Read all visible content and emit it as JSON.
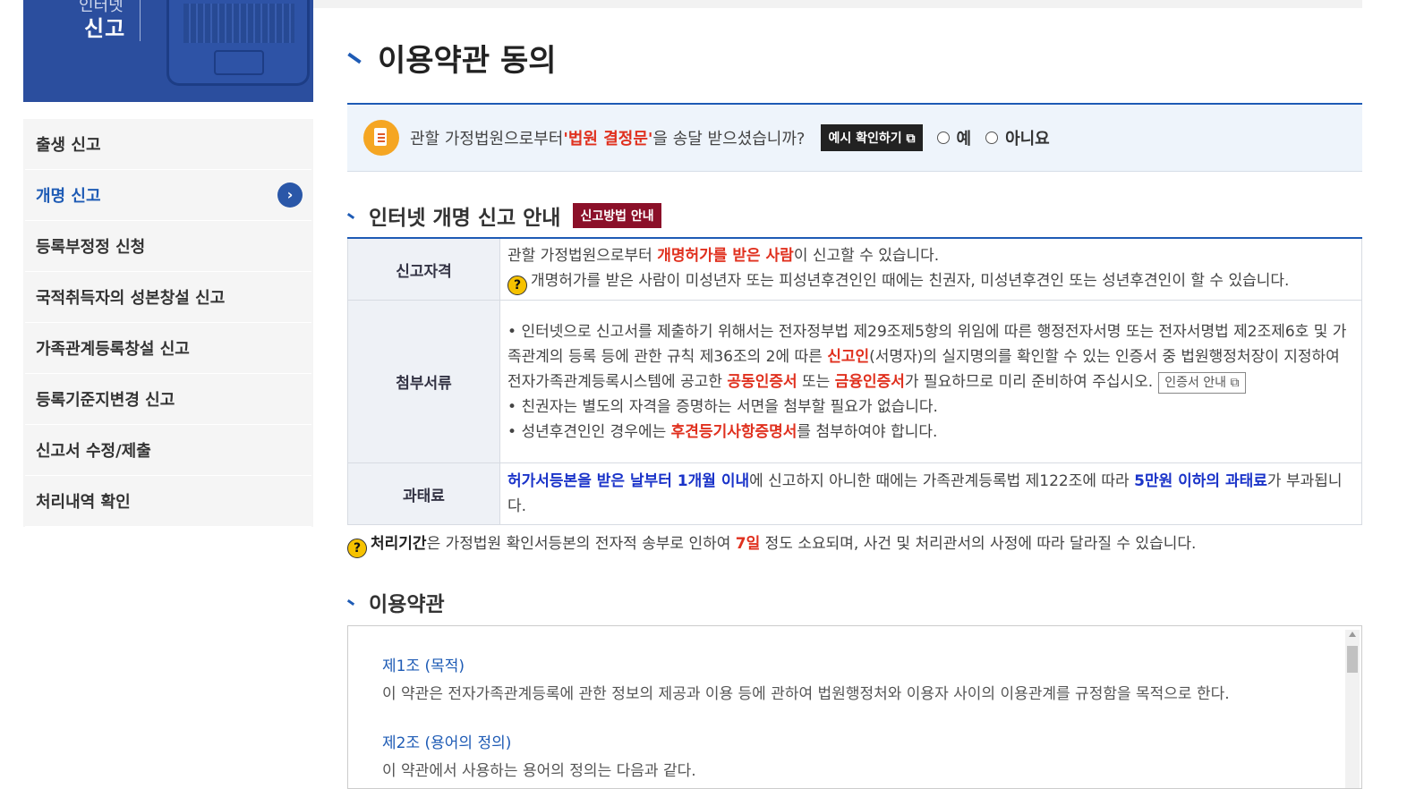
{
  "banner": {
    "text_top": "인터넷",
    "text": "신고"
  },
  "sidebar": {
    "items": [
      {
        "label": "출생 신고"
      },
      {
        "label": "개명 신고"
      },
      {
        "label": "등록부정정 신청"
      },
      {
        "label": "국적취득자의 성본창설 신고"
      },
      {
        "label": "가족관계등록창설 신고"
      },
      {
        "label": "등록기준지변경 신고"
      },
      {
        "label": "신고서 수정/제출"
      },
      {
        "label": "처리내역 확인"
      }
    ],
    "active_index": 1,
    "arrow_icon": "chevron-right-icon"
  },
  "page": {
    "title": "이용약관 동의"
  },
  "notice": {
    "pre": "관할 가정법원으로부터 ",
    "highlight": "'법원 결정문'",
    "post": "을 송달 받으셨습니까?",
    "example_button": "예시 확인하기",
    "radio_yes": "예",
    "radio_no": "아니요"
  },
  "guide": {
    "title": "인터넷 개명 신고 안내",
    "badge": "신고방법 안내",
    "rows": {
      "qualification": {
        "header": "신고자격",
        "line1_pre": "관할 가정법원으로부터 ",
        "line1_hl": "개명허가를 받은 사람",
        "line1_post": "이 신고할 수 있습니다.",
        "line2": "개명허가를 받은 사람이 미성년자 또는 피성년후견인인 때에는 친권자, 미성년후견인 또는 성년후견인이 할 수 있습니다."
      },
      "documents": {
        "header": "첨부서류",
        "b1_a": "인터넷으로 신고서를 제출하기 위해서는 전자정부법 제29조제5항의 위임에 따른 행정전자서명 또는 전자서명법 제2조제6호 및 가족관계의 등록 등에 관한 규칙 제36조의 2에 따른 ",
        "b1_hl1": "신고인",
        "b1_b": "(서명자)의 실지명의를 확인할 수 있는 인증서 중 법원행정처장이 지정하여 전자가족관계등록시스템에 공고한 ",
        "b1_hl2": "공동인증서",
        "b1_c": " 또는 ",
        "b1_hl3": "금융인증서",
        "b1_d": "가 필요하므로 미리 준비하여 주십시오.",
        "cert_button": "인증서 안내",
        "b2": "친권자는 별도의 자격을 증명하는 서면을 첨부할 필요가 없습니다.",
        "b3_a": "성년후견인인 경우에는 ",
        "b3_hl": "후견등기사항증명서",
        "b3_b": "를 첨부하여야 합니다."
      },
      "fine": {
        "header": "과태료",
        "hl1": "허가서등본을 받은 날부터 1개월 이내",
        "mid": "에 신고하지 아니한 때에는 가족관계등록법 제122조에 따라 ",
        "hl2": "5만원 이하의 과태료",
        "post": "가 부과됩니다."
      }
    },
    "period": {
      "label": "처리기간",
      "pre": "은 가정법원 확인서등본의 전자적 송부로 인하여 ",
      "days": "7일",
      "post": " 정도 소요되며, 사건 및 처리관서의 사정에 따라 달라질 수 있습니다."
    }
  },
  "terms": {
    "title": "이용약관",
    "articles": [
      {
        "heading": "제1조 (목적)",
        "body": "이 약관은 전자가족관계등록에 관한 정보의 제공과 이용 등에 관하여 법원행정처와 이용자 사이의 이용관계를 규정함을 목적으로 한다."
      },
      {
        "heading": "제2조 (용어의 정의)",
        "body": "이 약관에서 사용하는 용어의 정의는 다음과 같다."
      }
    ]
  }
}
